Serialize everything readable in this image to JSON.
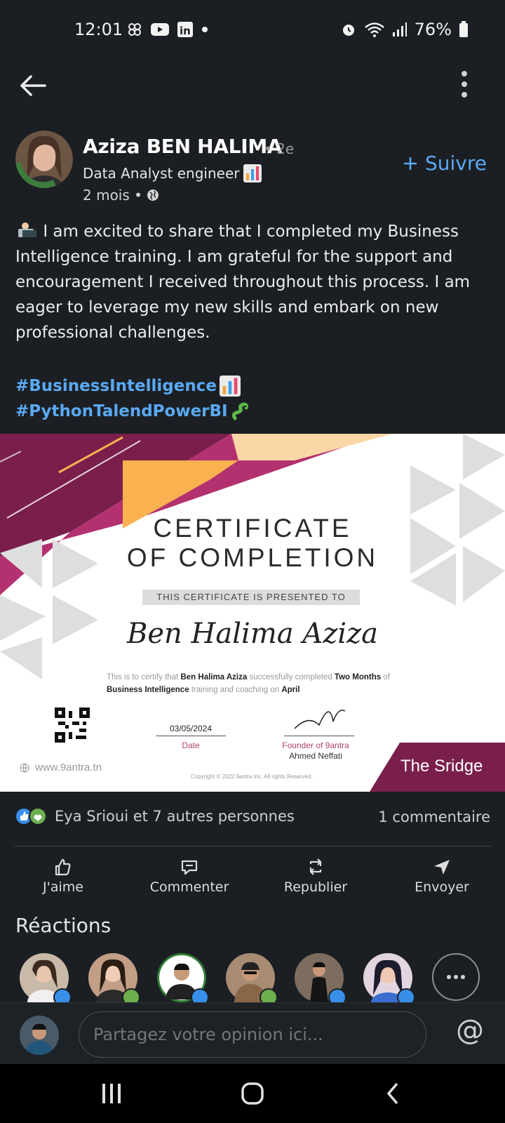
{
  "status_bar": {
    "time": "12:01",
    "battery": "76%",
    "icons": [
      "pinwheel-icon",
      "youtube-icon",
      "linkedin-icon",
      "dot-icon",
      "alarm-icon",
      "wifi-icon",
      "signal-icon",
      "battery-icon"
    ]
  },
  "top_bar": {
    "back_icon": "arrow-left-icon",
    "more_icon": "vertical-dots-icon"
  },
  "post": {
    "author": {
      "name": "Aziza BEN HALIMA",
      "degree": "• 2e",
      "headline": "Data Analyst engineer",
      "headline_emoji": "bar-chart-icon",
      "time": "2 mois •",
      "visibility_icon": "globe-icon",
      "avatar_badge": "#OPENTOWORK"
    },
    "follow_label": "Suivre",
    "text": "I am excited to share that I completed my Business Intelligence training. I am grateful for the support and encouragement I received throughout this process. I am eager to leverage my new skills and embark on new professional challenges.",
    "hashtags": [
      {
        "text": "#BusinessIntelligence",
        "emoji": "bar-chart-icon"
      },
      {
        "text": "#PythonTalendPowerBI",
        "emoji": "snake-icon"
      }
    ]
  },
  "certificate": {
    "title_line1": "CERTIFICATE",
    "title_line2": "OF COMPLETION",
    "presented": "THIS CERTIFICATE IS PRESENTED TO",
    "recipient": "Ben Halima Aziza",
    "body_prefix": "This is to certify that",
    "body_name": "Ben Halima Aziza",
    "body_mid": "successfully completed",
    "body_duration": "Two Months",
    "body_of": "of",
    "body_course": "Business Intelligence",
    "body_training": "training and coaching on",
    "body_month": "April",
    "date": "03/05/2024",
    "date_label": "Date",
    "founder_label": "Founder of 9antra",
    "founder_name": "Ahmed Neffati",
    "website": "www.9antra.tn",
    "copyright": "Copyright © 2022 9antra Inc. All rights Reserved.",
    "brand": "The Sridge",
    "colors": {
      "maroon": "#7a1f4b",
      "pink": "#b43170",
      "orange": "#f9b24f",
      "peach": "#fbd7a7"
    }
  },
  "social": {
    "reactors": "Eya Srioui et 7 autres personnes",
    "comments": "1 commentaire"
  },
  "actions": [
    {
      "label": "J'aime",
      "icon": "thumbs-up-icon"
    },
    {
      "label": "Commenter",
      "icon": "comment-icon"
    },
    {
      "label": "Republier",
      "icon": "repost-icon"
    },
    {
      "label": "Envoyer",
      "icon": "send-icon"
    }
  ],
  "reactions": {
    "title": "Réactions",
    "users": [
      {
        "badge": "like",
        "color": "#c9b9a8"
      },
      {
        "badge": "support",
        "color": "#c29e87"
      },
      {
        "badge": "like",
        "color": "#2e7d32"
      },
      {
        "badge": "support",
        "color": "#a78b73"
      },
      {
        "badge": "like",
        "color": "#7d6d5f"
      },
      {
        "badge": "like",
        "color": "#e3d5e0"
      }
    ]
  },
  "comment_bar": {
    "placeholder": "Partagez votre opinion ici...",
    "mention_icon": "at-icon"
  },
  "nav_bar": {
    "items": [
      "recents-icon",
      "home-icon",
      "back-icon"
    ]
  },
  "accent": "#5aa9f4"
}
